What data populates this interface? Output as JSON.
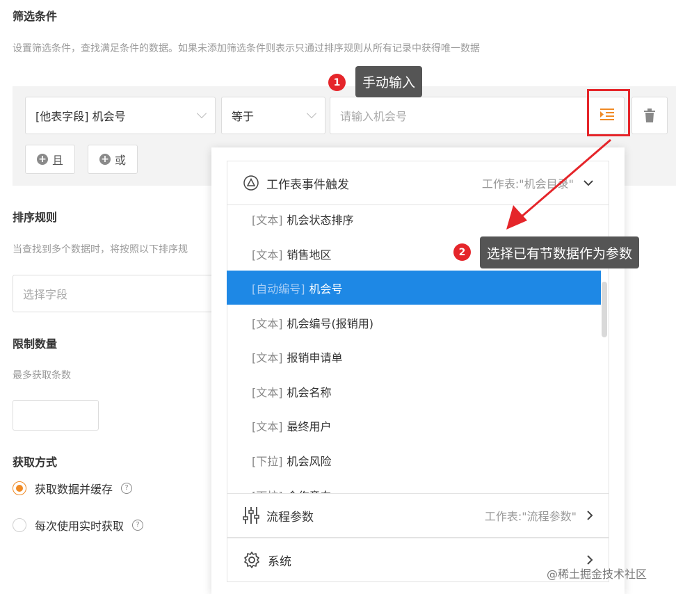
{
  "filter": {
    "title": "筛选条件",
    "description": "设置筛选条件，查找满足条件的数据。如果未添加筛选条件则表示只通过排序规则从所有记录中获得唯一数据",
    "field_value": "[他表字段] 机会号",
    "operator_value": "等于",
    "value_placeholder": "请输入机会号",
    "and_label": "且",
    "or_label": "或"
  },
  "sort": {
    "title": "排序规则",
    "description": "当查找到多个数据时，将按照以下排序规",
    "field_placeholder": "选择字段"
  },
  "limit": {
    "title": "限制数量",
    "description": "最多获取条数",
    "value": ""
  },
  "fetch": {
    "title": "获取方式",
    "options": [
      {
        "label": "获取数据并缓存",
        "selected": true
      },
      {
        "label": "每次使用实时获取",
        "selected": false
      }
    ]
  },
  "dropdown": {
    "groups": [
      {
        "name": "工作表事件触发",
        "source": "工作表:\"机会目录\"",
        "icon": "triangle-circle-icon",
        "expanded": true
      },
      {
        "name": "流程参数",
        "source": "工作表:\"流程参数\"",
        "icon": "sliders-icon",
        "expanded": false
      },
      {
        "name": "系统",
        "source": "",
        "icon": "gear-icon",
        "expanded": false
      }
    ],
    "items": [
      {
        "type": "[文本]",
        "name": "机会状态排序",
        "selected": false
      },
      {
        "type": "[文本]",
        "name": "销售地区",
        "selected": false
      },
      {
        "type": "[自动编号]",
        "name": "机会号",
        "selected": true
      },
      {
        "type": "[文本]",
        "name": "机会编号(报销用)",
        "selected": false
      },
      {
        "type": "[文本]",
        "name": "报销申请单",
        "selected": false
      },
      {
        "type": "[文本]",
        "name": "机会名称",
        "selected": false
      },
      {
        "type": "[文本]",
        "name": "最终用户",
        "selected": false
      },
      {
        "type": "[下拉]",
        "name": "机会风险",
        "selected": false
      },
      {
        "type": "[下拉]",
        "name": "合作意向",
        "selected": false
      }
    ]
  },
  "annotations": {
    "callout1": {
      "number": "1",
      "text": "手动输入"
    },
    "callout2": {
      "number": "2",
      "text": "选择已有节数据作为参数"
    },
    "accent_color": "#e5252a"
  },
  "watermark": "@稀土掘金技术社区",
  "colors": {
    "selected_row": "#1e88e5",
    "accent_orange": "#f08a24"
  }
}
